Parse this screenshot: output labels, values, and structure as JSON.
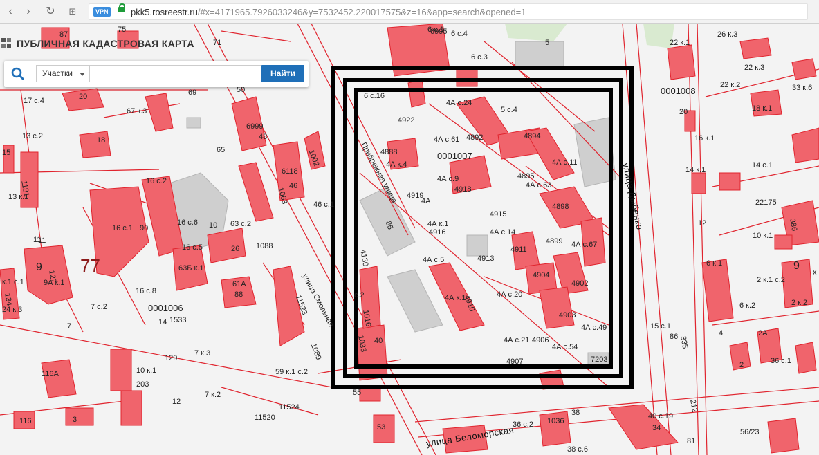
{
  "browser": {
    "back_icon": "chevron-left-icon",
    "forward_icon": "chevron-right-icon",
    "reload_icon": "reload-icon",
    "apps_icon": "grid-icon",
    "vpn_badge": "VPN",
    "url_host": "pkk5.rosreestr.ru",
    "url_path": "/#x=4171965.7926033246&y=7532452.220017575&z=16&app=search&opened=1"
  },
  "app": {
    "title": "ПУБЛИЧНАЯ КАДАСТРОВАЯ КАРТА",
    "search": {
      "type_selected": "Участки",
      "query_value": "",
      "find_label": "Найти"
    }
  },
  "map": {
    "big_numbers": [
      "77",
      "9"
    ],
    "street_names": [
      "улица Дыбенко",
      "улица Беломорская",
      "Прибрежная улица",
      "улица Смольная"
    ],
    "quarter_ids": [
      "0001006",
      "0001007",
      "0001008"
    ],
    "labels": [
      {
        "t": "87",
        "k": "a1"
      },
      {
        "t": "75",
        "k": "a2"
      },
      {
        "t": "71",
        "k": "a3"
      },
      {
        "t": "69",
        "k": "a4"
      },
      {
        "t": "17 с.4",
        "k": "a5"
      },
      {
        "t": "20",
        "k": "a6"
      },
      {
        "t": "50",
        "k": "a7"
      },
      {
        "t": "67 к.3",
        "k": "a8"
      },
      {
        "t": "13 с.2",
        "k": "a9"
      },
      {
        "t": "18",
        "k": "a10"
      },
      {
        "t": "65",
        "k": "a11"
      },
      {
        "t": "6999",
        "k": "a12"
      },
      {
        "t": "48",
        "k": "a13"
      },
      {
        "t": "15",
        "k": "a14"
      },
      {
        "t": "16 с.2",
        "k": "a15"
      },
      {
        "t": "6118",
        "k": "a16"
      },
      {
        "t": "46",
        "k": "a17"
      },
      {
        "t": "13 к.1",
        "k": "a18"
      },
      {
        "t": "16 с.1",
        "k": "a19"
      },
      {
        "t": "90",
        "k": "a20"
      },
      {
        "t": "16 с.6",
        "k": "a21"
      },
      {
        "t": "10",
        "k": "a22"
      },
      {
        "t": "63 с.2",
        "k": "a23"
      },
      {
        "t": "46 с.1",
        "k": "a24"
      },
      {
        "t": "11",
        "k": "a25"
      },
      {
        "t": "16 с.5",
        "k": "a26"
      },
      {
        "t": "26",
        "k": "a27"
      },
      {
        "t": "1088",
        "k": "a28"
      },
      {
        "t": "63Б к.1",
        "k": "a29"
      },
      {
        "t": "9А к.1",
        "k": "a30"
      },
      {
        "t": "к.1 с.1",
        "k": "a31"
      },
      {
        "t": "16 с.8",
        "k": "a32"
      },
      {
        "t": "61А",
        "k": "a33"
      },
      {
        "t": "88",
        "k": "a34"
      },
      {
        "t": "7 с.2",
        "k": "a35"
      },
      {
        "t": "24 к.3",
        "k": "a36"
      },
      {
        "t": "14",
        "k": "a37"
      },
      {
        "t": "1533",
        "k": "a38"
      },
      {
        "t": "7",
        "k": "a39"
      },
      {
        "t": "129",
        "k": "a40"
      },
      {
        "t": "7 к.3",
        "k": "a41"
      },
      {
        "t": "10 к.1",
        "k": "a42"
      },
      {
        "t": "116А",
        "k": "a43"
      },
      {
        "t": "203",
        "k": "a44"
      },
      {
        "t": "59 к.1 с.2",
        "k": "a45"
      },
      {
        "t": "7 к.2",
        "k": "a46"
      },
      {
        "t": "12",
        "k": "a47"
      },
      {
        "t": "55",
        "k": "a48"
      },
      {
        "t": "11520",
        "k": "a49"
      },
      {
        "t": "11524",
        "k": "a50"
      },
      {
        "t": "116",
        "k": "a51"
      },
      {
        "t": "3",
        "k": "a52"
      },
      {
        "t": "53",
        "k": "a53"
      },
      {
        "t": "6 с.1",
        "k": "a54"
      },
      {
        "t": "6 с.4",
        "k": "a55"
      },
      {
        "t": "6995",
        "k": "a56"
      },
      {
        "t": "5",
        "k": "a57"
      },
      {
        "t": "6 с.3",
        "k": "a58"
      },
      {
        "t": "6 с.16",
        "k": "a59"
      },
      {
        "t": "4А с.24",
        "k": "a60"
      },
      {
        "t": "5 с.4",
        "k": "a61"
      },
      {
        "t": "4922",
        "k": "a62"
      },
      {
        "t": "4А с.61",
        "k": "a63"
      },
      {
        "t": "4892",
        "k": "a64"
      },
      {
        "t": "4894",
        "k": "a65"
      },
      {
        "t": "4888",
        "k": "a66"
      },
      {
        "t": "4А к.4",
        "k": "a67"
      },
      {
        "t": "4А с.11",
        "k": "a68"
      },
      {
        "t": "4А с.9",
        "k": "a69"
      },
      {
        "t": "4918",
        "k": "a70"
      },
      {
        "t": "4895",
        "k": "a71"
      },
      {
        "t": "4А с.63",
        "k": "a72"
      },
      {
        "t": "4919",
        "k": "a73"
      },
      {
        "t": "4А",
        "k": "a74"
      },
      {
        "t": "4898",
        "k": "a75"
      },
      {
        "t": "4915",
        "k": "a76"
      },
      {
        "t": "4А к.1",
        "k": "a77"
      },
      {
        "t": "4916",
        "k": "a78"
      },
      {
        "t": "4А с.14",
        "k": "a79"
      },
      {
        "t": "4899",
        "k": "a80"
      },
      {
        "t": "4А с.67",
        "k": "a81"
      },
      {
        "t": "4911",
        "k": "a82"
      },
      {
        "t": "4130",
        "k": "a83"
      },
      {
        "t": "4А с.5",
        "k": "a84"
      },
      {
        "t": "4913",
        "k": "a85"
      },
      {
        "t": "4904",
        "k": "a86"
      },
      {
        "t": "4902",
        "k": "a87"
      },
      {
        "t": "4А с.20",
        "k": "a88"
      },
      {
        "t": "4910",
        "k": "a89"
      },
      {
        "t": "4А к.1",
        "k": "a90"
      },
      {
        "t": "4903",
        "k": "a91"
      },
      {
        "t": "4А с.49",
        "k": "a92"
      },
      {
        "t": "4А с.21",
        "k": "a93"
      },
      {
        "t": "4906",
        "k": "a94"
      },
      {
        "t": "4А с.54",
        "k": "a95"
      },
      {
        "t": "4907",
        "k": "a96"
      },
      {
        "t": "7203",
        "k": "a97"
      },
      {
        "t": "40",
        "k": "a98"
      },
      {
        "t": "1033",
        "k": "a99"
      },
      {
        "t": "22 к.1",
        "k": "a100"
      },
      {
        "t": "26 к.3",
        "k": "a101"
      },
      {
        "t": "22 к.3",
        "k": "a102"
      },
      {
        "t": "22 к.2",
        "k": "a103"
      },
      {
        "t": "33 к.6",
        "k": "a104"
      },
      {
        "t": "20",
        "k": "a105"
      },
      {
        "t": "18 к.1",
        "k": "a106"
      },
      {
        "t": "16 к.1",
        "k": "a107"
      },
      {
        "t": "14 к.1",
        "k": "a108"
      },
      {
        "t": "14 с.1",
        "k": "a109"
      },
      {
        "t": "22175",
        "k": "a110"
      },
      {
        "t": "12",
        "k": "a111"
      },
      {
        "t": "10 к.1",
        "k": "a112"
      },
      {
        "t": "6 к.1",
        "k": "a113"
      },
      {
        "t": "2 к.1 с.2",
        "k": "a114"
      },
      {
        "t": "6 к.2",
        "k": "a115"
      },
      {
        "t": "2 к.2",
        "k": "a116"
      },
      {
        "t": "15 с.1",
        "k": "a117"
      },
      {
        "t": "86",
        "k": "a118"
      },
      {
        "t": "4",
        "k": "a119"
      },
      {
        "t": "2А",
        "k": "a120"
      },
      {
        "t": "2",
        "k": "a121"
      },
      {
        "t": "36 с.1",
        "k": "a122"
      },
      {
        "t": "38",
        "k": "a123"
      },
      {
        "t": "1036",
        "k": "a124"
      },
      {
        "t": "36 с.2",
        "k": "a125"
      },
      {
        "t": "40 с.19",
        "k": "a126"
      },
      {
        "t": "34",
        "k": "a127"
      },
      {
        "t": "38 с.6",
        "k": "a128"
      },
      {
        "t": "56/23",
        "k": "a129"
      },
      {
        "t": "81",
        "k": "a130"
      },
      {
        "t": "335",
        "k": "a131"
      },
      {
        "t": "212",
        "k": "a132"
      },
      {
        "t": "386",
        "k": "a133"
      },
      {
        "t": "1089",
        "k": "a134"
      },
      {
        "t": "11523",
        "k": "a135"
      },
      {
        "t": "1002",
        "k": "a136"
      },
      {
        "t": "1063",
        "k": "a137"
      },
      {
        "t": "1181",
        "k": "a138"
      },
      {
        "t": "134",
        "k": "a139"
      },
      {
        "t": "127",
        "k": "a140"
      },
      {
        "t": "11",
        "k": "a141"
      },
      {
        "t": "1016",
        "k": "a142"
      },
      {
        "t": "с.2",
        "k": "a143"
      },
      {
        "t": "85",
        "k": "a144"
      },
      {
        "t": "х",
        "k": "a145"
      }
    ]
  },
  "colors": {
    "parcel_fill": "#f0646c",
    "parcel_stroke": "#e0242e",
    "selection_frame": "#000000",
    "find_button": "#1f6fb8"
  }
}
